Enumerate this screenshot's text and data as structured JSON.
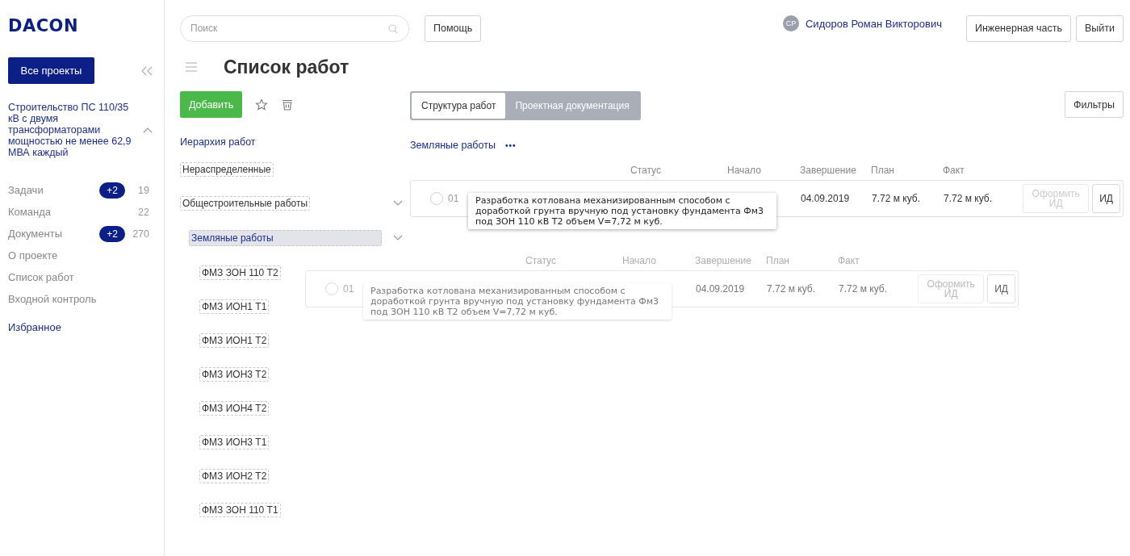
{
  "sidebar": {
    "logo": "DACON",
    "all_projects_button": "Все проекты",
    "project_title": "Строительство ПС 110/35 кВ с двумя трансформаторами мощностью не менее 62,9 МВА каждый",
    "project_expanded": true,
    "nav": [
      {
        "label": "Задачи",
        "badge": "+2",
        "count": "19"
      },
      {
        "label": "Команда",
        "count": "22"
      },
      {
        "label": "Документы",
        "badge": "+2",
        "count": "270"
      },
      {
        "label": "О проекте"
      },
      {
        "label": "Список работ"
      },
      {
        "label": "Входной контроль"
      }
    ],
    "favorites": "Избранное"
  },
  "topbar": {
    "search": {
      "placeholder": "Поиск"
    },
    "help_button": "Помощь",
    "user": {
      "initials": "СР",
      "name": "Сидоров Роман Викторович"
    },
    "buttons": [
      "Инженерная часть",
      "Выйти"
    ]
  },
  "page_title": "Список работ",
  "toolbar": {
    "add_button": "Добавить"
  },
  "hierarchy": {
    "title": "Иерархия работ",
    "items": [
      {
        "label": "Нераспределенные",
        "selected": false
      },
      {
        "label": "Общестроительные работы",
        "expanded": true,
        "selected": false,
        "children": [
          {
            "label": "Земляные работы",
            "expanded": true,
            "selected": true,
            "children": [
              {
                "label": "ФМЗ ЗОН 110 Т2",
                "selected": false
              },
              {
                "label": "ФМЗ ИОН1 Т1",
                "selected": false
              },
              {
                "label": "ФМЗ ИОН1 Т2",
                "selected": false
              },
              {
                "label": "ФМЗ ИОН3 Т2",
                "selected": false
              },
              {
                "label": "ФМЗ ИОН4 Т2",
                "selected": false
              },
              {
                "label": "ФМЗ ИОН3 Т1",
                "selected": false
              },
              {
                "label": "ФМЗ ИОН2 Т2",
                "selected": false
              },
              {
                "label": "ФМЗ ЗОН 110 Т1",
                "selected": false
              }
            ]
          }
        ]
      }
    ]
  },
  "tabs": [
    {
      "label": "Структура работ",
      "selected": true
    },
    {
      "label": "Проектная документация",
      "selected": false
    }
  ],
  "filters_button": "Фильтры",
  "breadcrumb": {
    "label": "Земляные работы",
    "more": "•••"
  },
  "table": {
    "columns": [
      "Статус",
      "Начало",
      "Завершение",
      "План",
      "Факт"
    ],
    "row": {
      "number": "01",
      "checked": false,
      "end": "04.09.2019",
      "plan": "7.72 м куб.",
      "fact": "7.72 м куб.",
      "actions": [
        {
          "label": "Оформить ИД",
          "disabled": true
        },
        {
          "label": "ИД",
          "disabled": false
        }
      ],
      "tooltip": "Разработка котлована механизированным способом с доработкой грунта вручную под установку фундамента Фм3 под ЗОН 110 кВ Т2 объем V=7,72 м куб."
    }
  },
  "drag_ghost": {
    "columns": [
      "Статус",
      "Начало",
      "Завершение",
      "План",
      "Факт"
    ],
    "row": {
      "number": "01",
      "checked": false,
      "end": "04.09.2019",
      "plan": "7.72 м куб.",
      "fact": "7.72 м куб.",
      "actions": [
        {
          "label": "Оформить ИД",
          "disabled": true
        },
        {
          "label": "ИД",
          "disabled": false
        }
      ],
      "tooltip": "Разработка котлована механизированным способом с доработкой грунта вручную под установку фундамента Фм3 под ЗОН 110 кВ Т2 объем V=7,72 м куб."
    }
  }
}
